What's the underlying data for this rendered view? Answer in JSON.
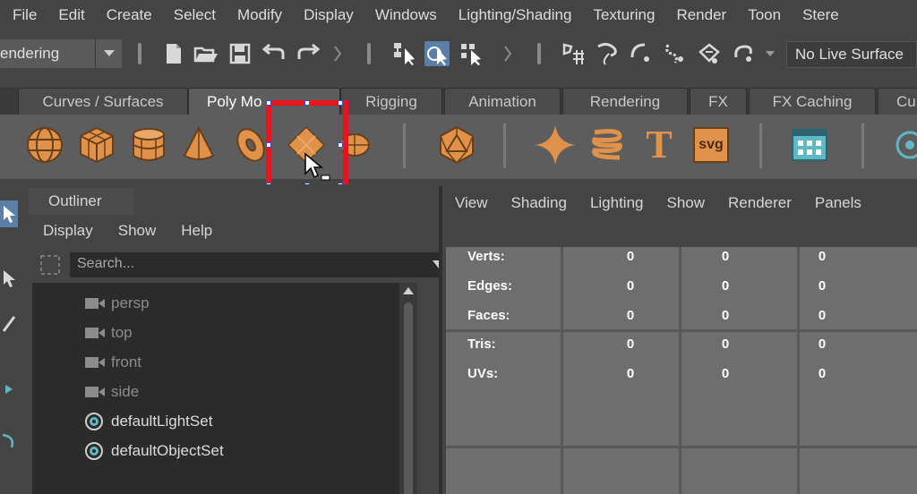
{
  "menubar": {
    "items": [
      "File",
      "Edit",
      "Create",
      "Select",
      "Modify",
      "Display",
      "Windows",
      "Lighting/Shading",
      "Texturing",
      "Render",
      "Toon",
      "Stere"
    ]
  },
  "statusline": {
    "mode": "endering",
    "live_surface": "No Live Surface"
  },
  "shelf": {
    "tabs": [
      "Curves / Surfaces",
      "Poly Modeling",
      "Rigging",
      "Animation",
      "Rendering",
      "FX",
      "FX Caching",
      "Cu"
    ],
    "active_tab": "Poly Modeling",
    "active_tab_visible": "Poly Mo",
    "icons": [
      "poly-sphere",
      "poly-cube",
      "poly-cylinder",
      "poly-cone",
      "poly-torus",
      "poly-plane",
      "poly-disc",
      "platonic-solid",
      "super-shape",
      "poly-helix",
      "type",
      "svg",
      "poly-grid",
      "camera-sphere"
    ],
    "svg_label": "svg",
    "type_label": "T",
    "highlighted_tool": "poly-plane"
  },
  "outliner": {
    "tab_label": "Outliner",
    "menu": [
      "Display",
      "Show",
      "Help"
    ],
    "search_placeholder": "Search...",
    "items": [
      {
        "label": "persp",
        "icon": "camera-icon",
        "dim": true
      },
      {
        "label": "top",
        "icon": "camera-icon",
        "dim": true
      },
      {
        "label": "front",
        "icon": "camera-icon",
        "dim": true
      },
      {
        "label": "side",
        "icon": "camera-icon",
        "dim": true
      },
      {
        "label": "defaultLightSet",
        "icon": "set-icon",
        "dim": false
      },
      {
        "label": "defaultObjectSet",
        "icon": "set-icon",
        "dim": false
      }
    ]
  },
  "viewport": {
    "menu": [
      "View",
      "Shading",
      "Lighting",
      "Show",
      "Renderer",
      "Panels"
    ],
    "hud": [
      {
        "label": "Verts:",
        "values": [
          "0",
          "0",
          "0"
        ]
      },
      {
        "label": "Edges:",
        "values": [
          "0",
          "0",
          "0"
        ]
      },
      {
        "label": "Faces:",
        "values": [
          "0",
          "0",
          "0"
        ]
      },
      {
        "label": "Tris:",
        "values": [
          "0",
          "0",
          "0"
        ]
      },
      {
        "label": "UVs:",
        "values": [
          "0",
          "0",
          "0"
        ]
      }
    ]
  },
  "colors": {
    "accent_orange": "#e0924a",
    "highlight_red": "#e8141e",
    "selection_blue": "#5b7fa6",
    "icon_teal": "#5fb8c4"
  }
}
